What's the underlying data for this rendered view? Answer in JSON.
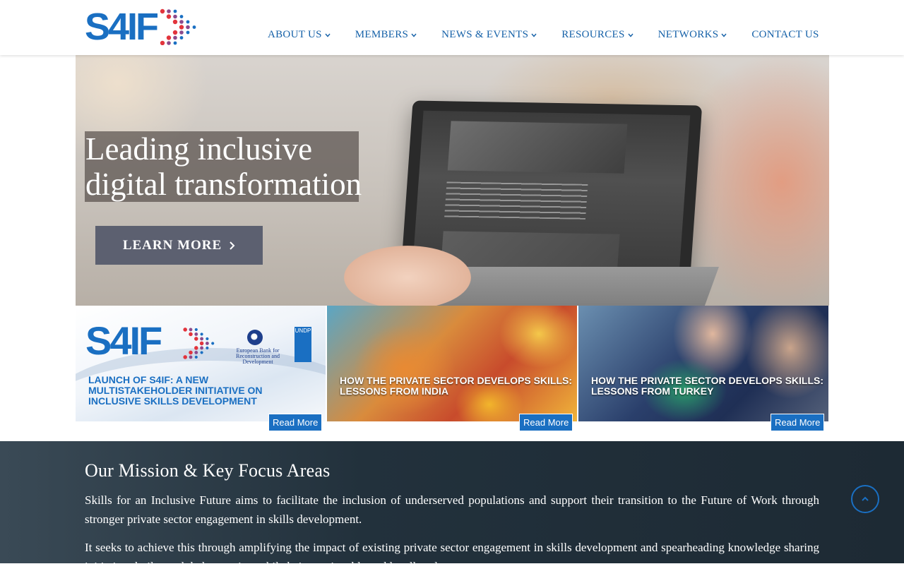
{
  "header": {
    "logo_text": "S4IF",
    "nav": [
      {
        "label": "ABOUT US",
        "has_dropdown": true
      },
      {
        "label": "MEMBERS",
        "has_dropdown": true
      },
      {
        "label": "NEWS & EVENTS",
        "has_dropdown": true
      },
      {
        "label": "RESOURCES",
        "has_dropdown": true
      },
      {
        "label": "NETWORKS",
        "has_dropdown": true
      },
      {
        "label": "CONTACT US",
        "has_dropdown": false
      }
    ]
  },
  "hero": {
    "headline_line1": "Leading inclusive",
    "headline_line2": "digital transformation",
    "cta_label": "LEARN MORE"
  },
  "cards": [
    {
      "title": "LAUNCH OF S4IF: A NEW MULTISTAKEHOLDER INITIATIVE ON INCLUSIVE SKILLS DEVELOPMENT",
      "button": "Read More",
      "logo_text": "S4IF",
      "partner1": "European Bank for Reconstruction and Development",
      "partner2": "UNDP"
    },
    {
      "title": "HOW THE PRIVATE SECTOR DEVELOPS SKILLS: LESSONS FROM INDIA",
      "button": "Read More"
    },
    {
      "title": "HOW THE PRIVATE SECTOR DEVELOPS SKILLS: LESSONS FROM TURKEY",
      "button": "Read More"
    }
  ],
  "mission": {
    "title": "Our Mission & Key Focus Areas",
    "p1": "Skills for an Inclusive Future aims to facilitate the inclusion of underserved populations and support their transition to the Future of Work through stronger private sector engagement in skills development.",
    "p2": "It seeks to achieve this through amplifying the impact of existing private sector engagement in skills development and spearheading knowledge sharing initiatives built on global expertise, while being actionable and locally relevant."
  },
  "colors": {
    "brand_blue": "#1a6fc2",
    "brand_red": "#e2343c",
    "nav_text": "#1561a8",
    "mission_bg": "#22313c",
    "cta_bg": "#5c6070"
  },
  "icons": {
    "nav_chevron": "chevron-down-icon",
    "cta_arrow": "chevron-right-icon",
    "scroll_top": "chevron-up-icon"
  }
}
